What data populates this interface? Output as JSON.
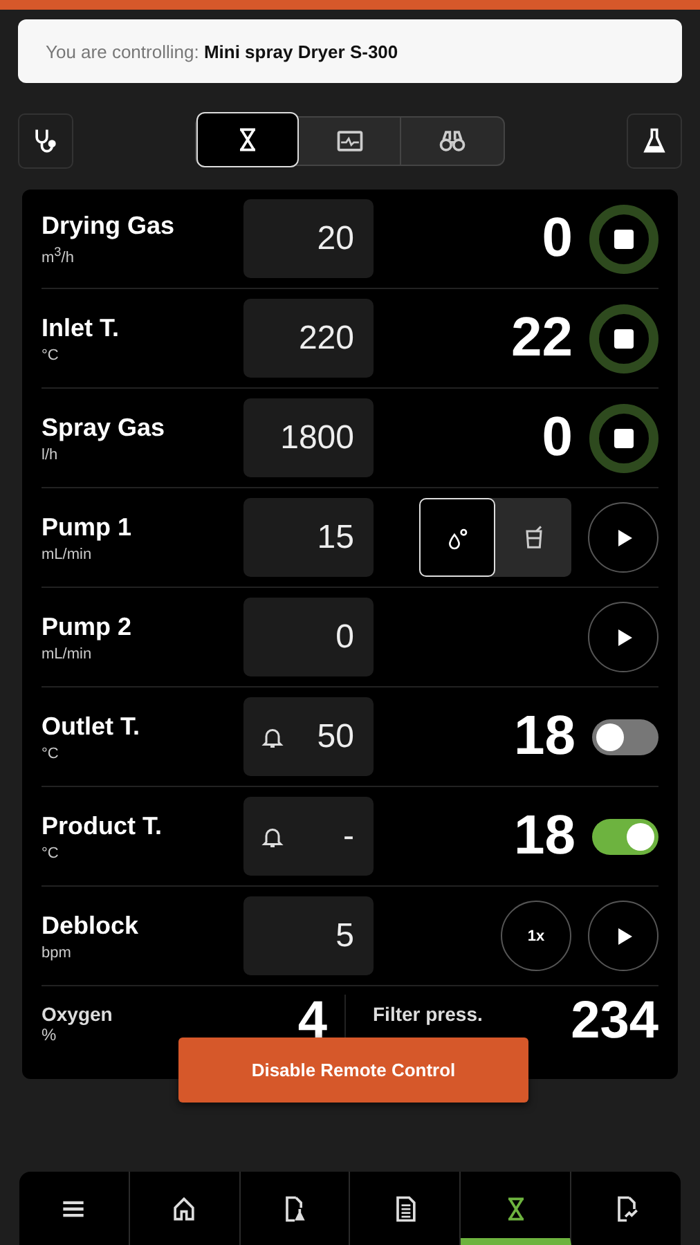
{
  "banner": {
    "prefix": "You are controlling:",
    "device": "Mini spray Dryer S-300"
  },
  "toolbar": {
    "tabs": [
      {
        "selected": true
      },
      {
        "selected": false
      },
      {
        "selected": false
      }
    ]
  },
  "rows": [
    {
      "kind": "stop",
      "name": "Drying Gas",
      "unit": "m$^{3}$/h",
      "setpoint": "20",
      "reading": "0"
    },
    {
      "kind": "stop",
      "name": "Inlet T.",
      "unit": "°C",
      "setpoint": "220",
      "reading": "22"
    },
    {
      "kind": "stop",
      "name": "Spray Gas",
      "unit": "l/h",
      "setpoint": "1800",
      "reading": "0"
    },
    {
      "kind": "pump",
      "name": "Pump 1",
      "unit": "mL/min",
      "setpoint": "15",
      "modes": [
        {
          "selected": true
        },
        {
          "selected": false
        }
      ]
    },
    {
      "kind": "pump",
      "name": "Pump 2",
      "unit": "mL/min",
      "setpoint": "0"
    },
    {
      "kind": "alarm",
      "name": "Outlet T.",
      "unit": "°C",
      "setpoint": "50",
      "reading": "18",
      "on": false
    },
    {
      "kind": "alarm",
      "name": "Product T.",
      "unit": "°C",
      "setpoint": "-",
      "reading": "18",
      "on": true
    },
    {
      "kind": "deblock",
      "name": "Deblock",
      "unit": "bpm",
      "setpoint": "5",
      "once": "1x"
    }
  ],
  "readings": [
    {
      "name": "Oxygen",
      "unit": "%",
      "value": "4"
    },
    {
      "name": "Filter press.",
      "value": "234"
    }
  ],
  "disable_button": "Disable Remote Control",
  "nav": [
    {
      "selected": false
    },
    {
      "selected": false
    },
    {
      "selected": false
    },
    {
      "selected": false
    },
    {
      "selected": true
    },
    {
      "selected": false
    }
  ]
}
